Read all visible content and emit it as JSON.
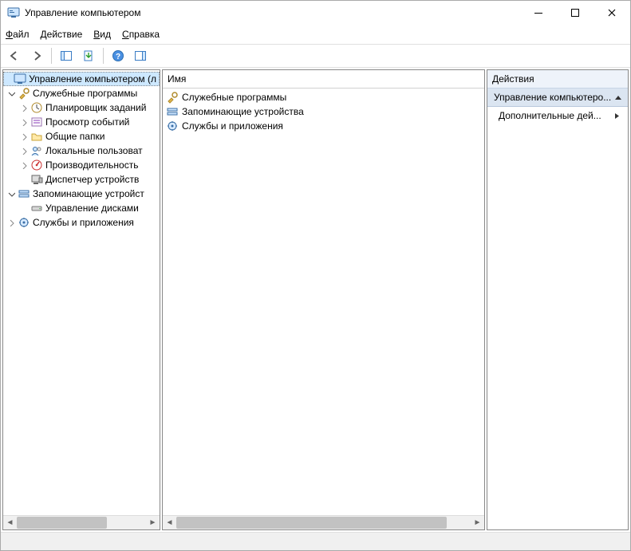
{
  "window": {
    "title": "Управление компьютером"
  },
  "menu": {
    "file": "Файл",
    "action": "Действие",
    "view": "Вид",
    "help": "Справка"
  },
  "tree": {
    "root": "Управление компьютером (л",
    "group1": {
      "label": "Служебные программы",
      "items": [
        "Планировщик заданий",
        "Просмотр событий",
        "Общие папки",
        "Локальные пользоват",
        "Производительность",
        "Диспетчер устройств"
      ]
    },
    "group2": {
      "label": "Запоминающие устройст",
      "items": [
        "Управление дисками"
      ]
    },
    "group3": {
      "label": "Службы и приложения"
    }
  },
  "center": {
    "header": "Имя",
    "items": [
      "Служебные программы",
      "Запоминающие устройства",
      "Службы и приложения"
    ]
  },
  "actions": {
    "header": "Действия",
    "group": "Управление компьютеро...",
    "more": "Дополнительные дей..."
  }
}
